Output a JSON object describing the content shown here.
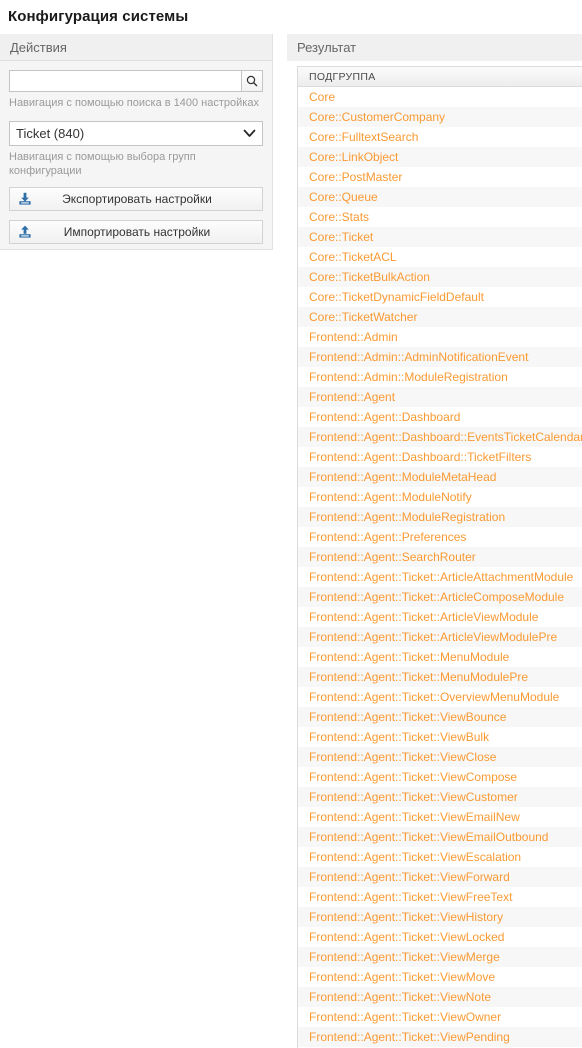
{
  "page": {
    "title": "Конфигурация системы"
  },
  "sidebar": {
    "header": "Действия",
    "search": {
      "value": "",
      "placeholder": "",
      "icon": "search-icon",
      "hint": "Навигация с помощью поиска в 1400 настройках"
    },
    "group_select": {
      "selected": "Ticket (840)",
      "caret_icon": "chevron-down-icon",
      "hint": "Навигация с помощью выбора групп конфигурации",
      "options": [
        "Ticket (840)"
      ]
    },
    "buttons": [
      {
        "label": "Экспортировать настройки",
        "icon": "download-icon"
      },
      {
        "label": "Импортировать настройки",
        "icon": "upload-icon"
      }
    ]
  },
  "result": {
    "header": "Результат",
    "column_header": "ПОДГРУППА",
    "link_color": "#fa9a33",
    "rows": [
      "Core",
      "Core::CustomerCompany",
      "Core::FulltextSearch",
      "Core::LinkObject",
      "Core::PostMaster",
      "Core::Queue",
      "Core::Stats",
      "Core::Ticket",
      "Core::TicketACL",
      "Core::TicketBulkAction",
      "Core::TicketDynamicFieldDefault",
      "Core::TicketWatcher",
      "Frontend::Admin",
      "Frontend::Admin::AdminNotificationEvent",
      "Frontend::Admin::ModuleRegistration",
      "Frontend::Agent",
      "Frontend::Agent::Dashboard",
      "Frontend::Agent::Dashboard::EventsTicketCalendar",
      "Frontend::Agent::Dashboard::TicketFilters",
      "Frontend::Agent::ModuleMetaHead",
      "Frontend::Agent::ModuleNotify",
      "Frontend::Agent::ModuleRegistration",
      "Frontend::Agent::Preferences",
      "Frontend::Agent::SearchRouter",
      "Frontend::Agent::Ticket::ArticleAttachmentModule",
      "Frontend::Agent::Ticket::ArticleComposeModule",
      "Frontend::Agent::Ticket::ArticleViewModule",
      "Frontend::Agent::Ticket::ArticleViewModulePre",
      "Frontend::Agent::Ticket::MenuModule",
      "Frontend::Agent::Ticket::MenuModulePre",
      "Frontend::Agent::Ticket::OverviewMenuModule",
      "Frontend::Agent::Ticket::ViewBounce",
      "Frontend::Agent::Ticket::ViewBulk",
      "Frontend::Agent::Ticket::ViewClose",
      "Frontend::Agent::Ticket::ViewCompose",
      "Frontend::Agent::Ticket::ViewCustomer",
      "Frontend::Agent::Ticket::ViewEmailNew",
      "Frontend::Agent::Ticket::ViewEmailOutbound",
      "Frontend::Agent::Ticket::ViewEscalation",
      "Frontend::Agent::Ticket::ViewForward",
      "Frontend::Agent::Ticket::ViewFreeText",
      "Frontend::Agent::Ticket::ViewHistory",
      "Frontend::Agent::Ticket::ViewLocked",
      "Frontend::Agent::Ticket::ViewMerge",
      "Frontend::Agent::Ticket::ViewMove",
      "Frontend::Agent::Ticket::ViewNote",
      "Frontend::Agent::Ticket::ViewOwner",
      "Frontend::Agent::Ticket::ViewPending"
    ]
  }
}
